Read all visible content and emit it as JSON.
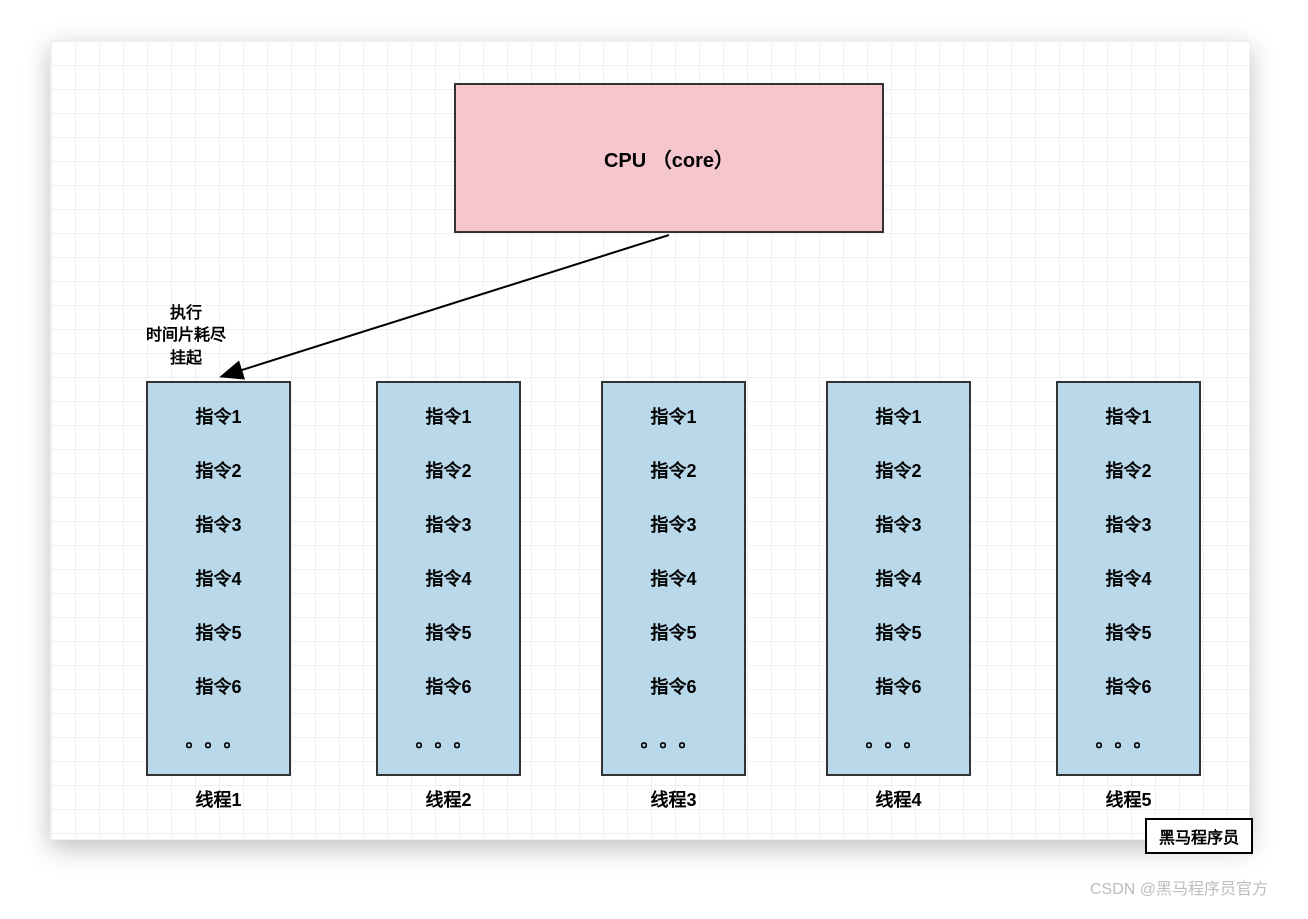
{
  "cpu": {
    "label": "CPU （core）"
  },
  "annotation": {
    "line1": "执行",
    "line2": "时间片耗尽",
    "line3": "挂起"
  },
  "threads": [
    {
      "label": "线程1",
      "instructions": [
        "指令1",
        "指令2",
        "指令3",
        "指令4",
        "指令5",
        "指令6"
      ],
      "more": "。。。"
    },
    {
      "label": "线程2",
      "instructions": [
        "指令1",
        "指令2",
        "指令3",
        "指令4",
        "指令5",
        "指令6"
      ],
      "more": "。。。"
    },
    {
      "label": "线程3",
      "instructions": [
        "指令1",
        "指令2",
        "指令3",
        "指令4",
        "指令5",
        "指令6"
      ],
      "more": "。。。"
    },
    {
      "label": "线程4",
      "instructions": [
        "指令1",
        "指令2",
        "指令3",
        "指令4",
        "指令5",
        "指令6"
      ],
      "more": "。。。"
    },
    {
      "label": "线程5",
      "instructions": [
        "指令1",
        "指令2",
        "指令3",
        "指令4",
        "指令5",
        "指令6"
      ],
      "more": "。。。"
    }
  ],
  "watermark": "黑马程序员",
  "credit": "CSDN @黑马程序员官方",
  "colors": {
    "cpu": "#f6c6cd",
    "thread": "#b9d9ea",
    "border": "#333333"
  }
}
